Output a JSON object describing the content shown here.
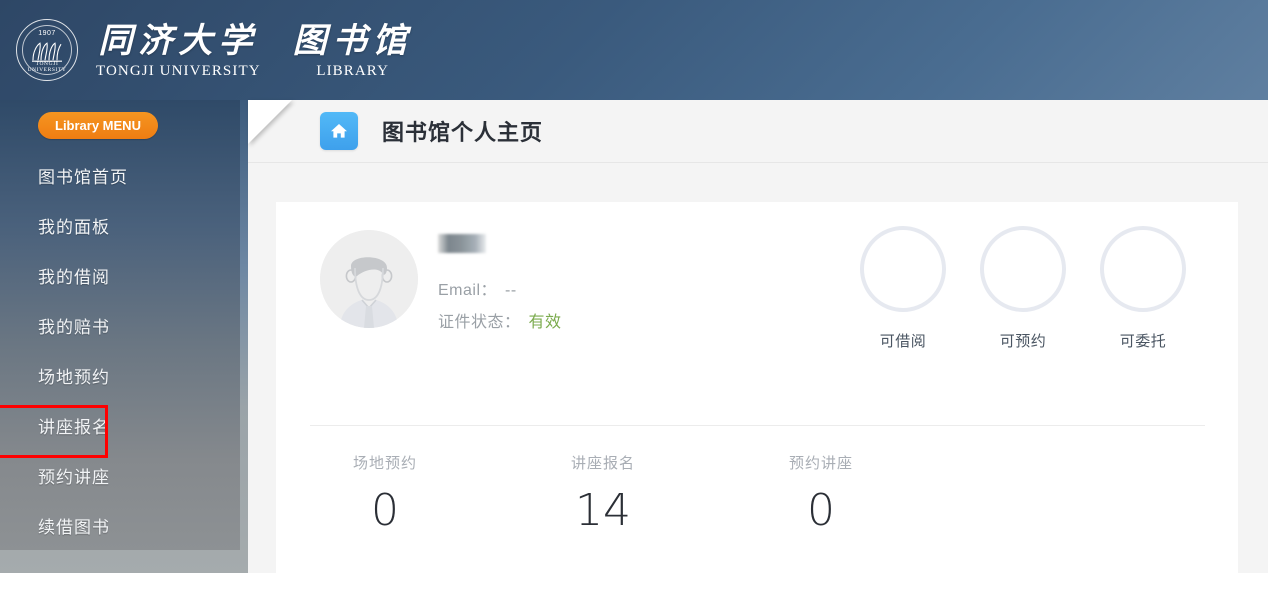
{
  "header": {
    "logo": {
      "seal_year": "1907",
      "seal_name": "TONGJI UNIVERSITY"
    },
    "brand": [
      {
        "cn": "同济大学",
        "en": "TONGJI UNIVERSITY"
      },
      {
        "cn": "图书馆",
        "en": "LIBRARY"
      }
    ]
  },
  "sidebar": {
    "menu_badge": "Library MENU",
    "highlighted_index": 5,
    "highlight_color": "#ff0000",
    "items": [
      {
        "label": "图书馆首页"
      },
      {
        "label": "我的面板"
      },
      {
        "label": "我的借阅"
      },
      {
        "label": "我的赔书"
      },
      {
        "label": "场地预约"
      },
      {
        "label": "讲座报名"
      },
      {
        "label": "预约讲座"
      },
      {
        "label": "续借图书"
      }
    ]
  },
  "page": {
    "title": "图书馆个人主页",
    "home_icon": "home-icon"
  },
  "profile": {
    "name": "",
    "name_redacted": true,
    "email_label": "Email：",
    "email_value": "--",
    "card_status_label": "证件状态：",
    "card_status_value": "有效",
    "card_status_color": "#7bab4d"
  },
  "rings": [
    {
      "label": "可借阅",
      "value": ""
    },
    {
      "label": "可预约",
      "value": ""
    },
    {
      "label": "可委托",
      "value": ""
    }
  ],
  "stats": [
    {
      "label": "场地预约",
      "value": "0"
    },
    {
      "label": "讲座报名",
      "value": "14"
    },
    {
      "label": "预约讲座",
      "value": "0"
    }
  ]
}
